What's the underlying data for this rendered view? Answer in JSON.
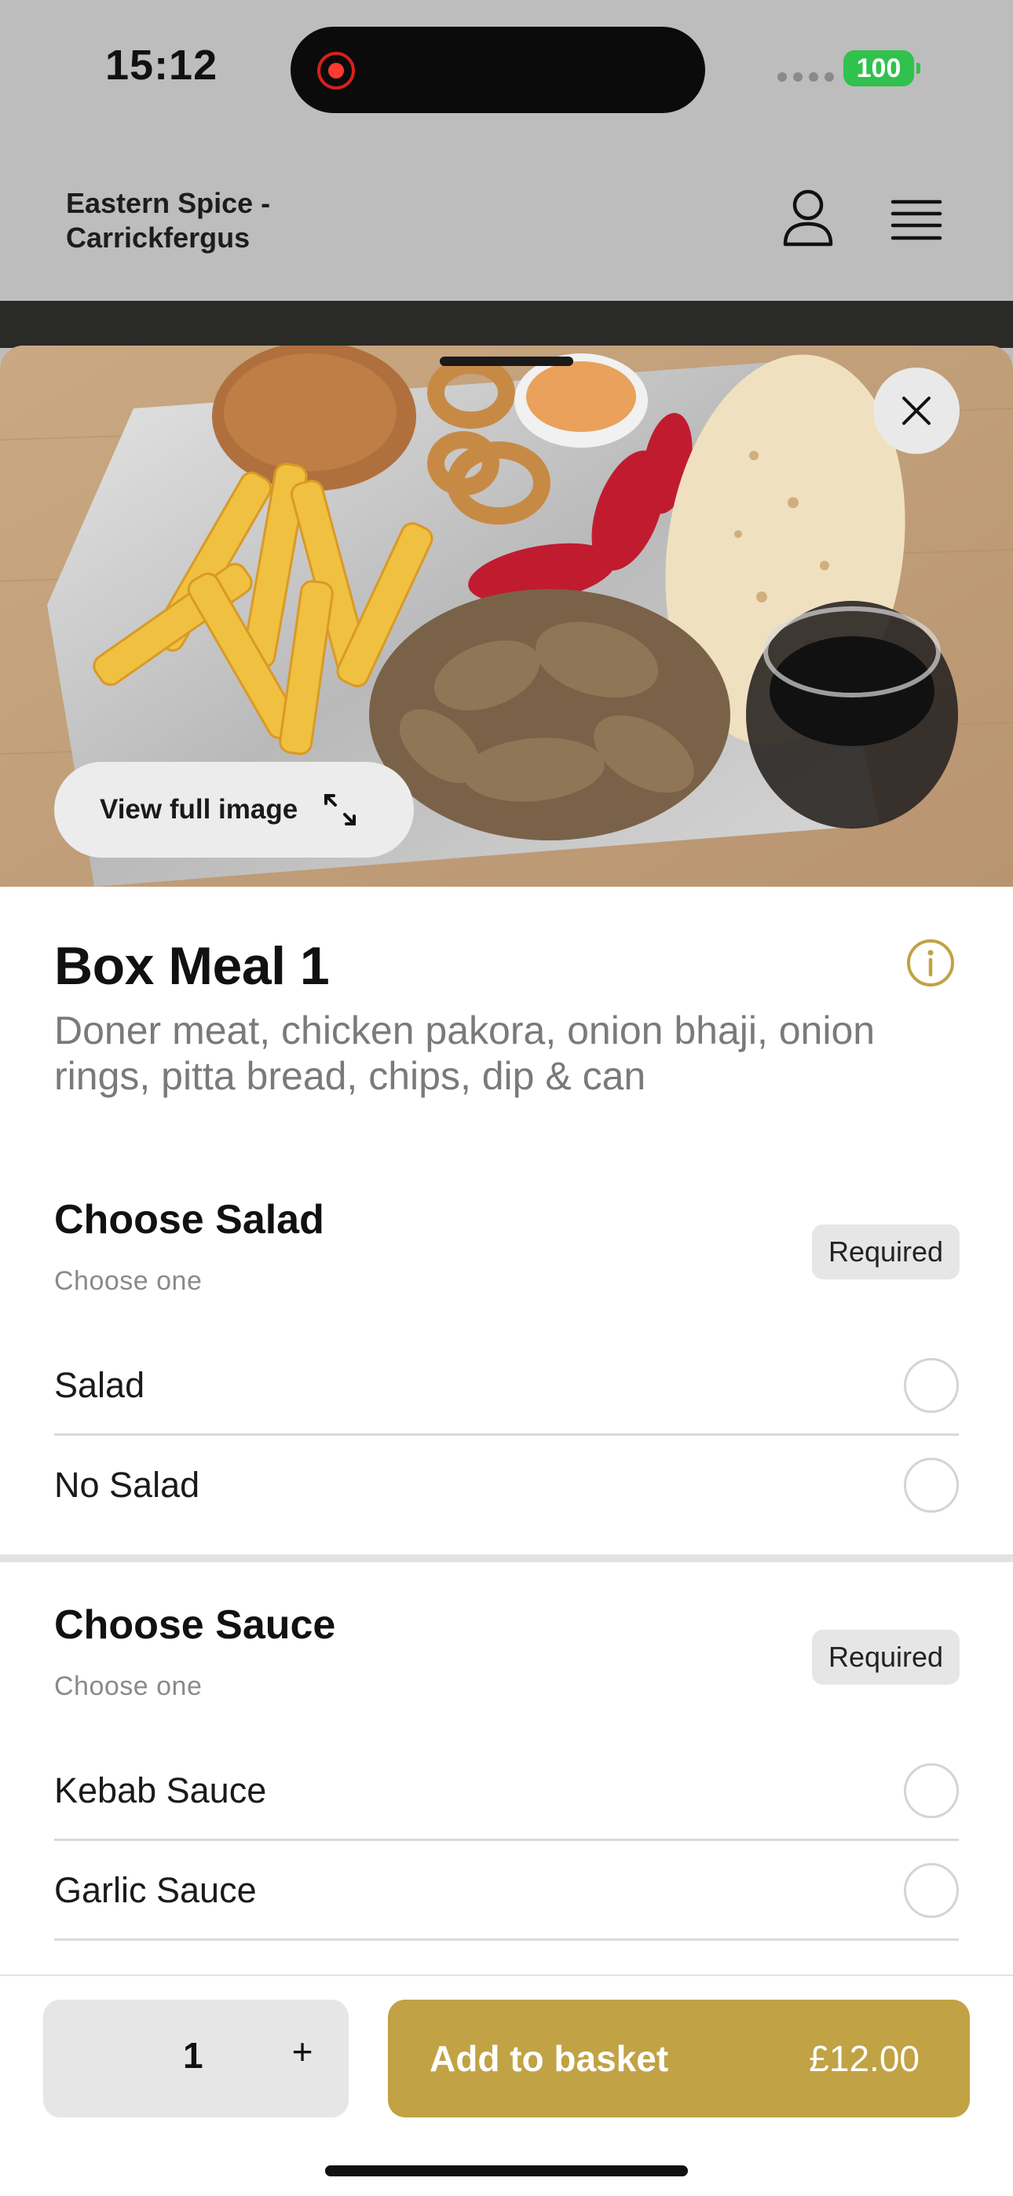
{
  "status_bar": {
    "time": "15:12",
    "battery": "100"
  },
  "header": {
    "restaurant_name_line1": "Eastern Spice -",
    "restaurant_name_line2": "Carrickfergus"
  },
  "hero": {
    "view_full_image_label": "View full image"
  },
  "item": {
    "title": "Box Meal 1",
    "description": "Doner meat, chicken pakora, onion bhaji, onion rings, pitta bread, chips, dip & can"
  },
  "groups": [
    {
      "title": "Choose Salad",
      "subtitle": "Choose one",
      "badge": "Required",
      "options": [
        {
          "label": "Salad"
        },
        {
          "label": "No Salad"
        }
      ]
    },
    {
      "title": "Choose Sauce",
      "subtitle": "Choose one",
      "badge": "Required",
      "options": [
        {
          "label": "Kebab Sauce"
        },
        {
          "label": "Garlic Sauce"
        }
      ]
    }
  ],
  "footer": {
    "quantity": "1",
    "plus": "+",
    "add_label": "Add to basket",
    "price": "£12.00"
  },
  "colors": {
    "accent": "#c1a244",
    "battery": "#30c24c",
    "recording": "#ff3b30"
  },
  "icons": [
    "user-icon",
    "menu-icon",
    "close-icon",
    "expand-icon",
    "info-icon",
    "recording-icon"
  ]
}
